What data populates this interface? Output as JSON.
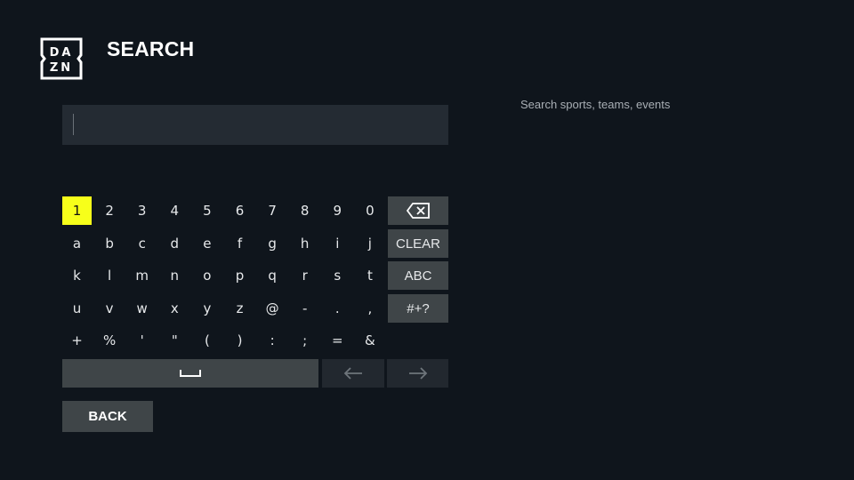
{
  "header": {
    "logo_top": "DA",
    "logo_bottom": "ZN",
    "title": "SEARCH"
  },
  "search": {
    "value": "",
    "hint": "Search sports, teams, events"
  },
  "keyboard": {
    "focused_key": "1",
    "rows": [
      [
        "1",
        "2",
        "3",
        "4",
        "5",
        "6",
        "7",
        "8",
        "9",
        "0"
      ],
      [
        "a",
        "b",
        "c",
        "d",
        "e",
        "f",
        "g",
        "h",
        "i",
        "j"
      ],
      [
        "k",
        "l",
        "m",
        "n",
        "o",
        "p",
        "q",
        "r",
        "s",
        "t"
      ],
      [
        "u",
        "v",
        "w",
        "x",
        "y",
        "z",
        "@",
        "-",
        ".",
        ","
      ],
      [
        "+",
        "%",
        "'",
        "\"",
        "(",
        ")",
        ":",
        ";",
        "=",
        "&"
      ]
    ],
    "side_keys": {
      "backspace_icon": "backspace-icon",
      "clear": "CLEAR",
      "abc": "ABC",
      "symbols": "#+?"
    },
    "space_icon": "space-icon",
    "left_icon": "arrow-left-icon",
    "right_icon": "arrow-right-icon"
  },
  "footer": {
    "back_label": "BACK"
  },
  "colors": {
    "background": "#0f151c",
    "focus": "#f7ff1a",
    "key_bg": "#3f4548",
    "field_bg": "#242b33"
  }
}
